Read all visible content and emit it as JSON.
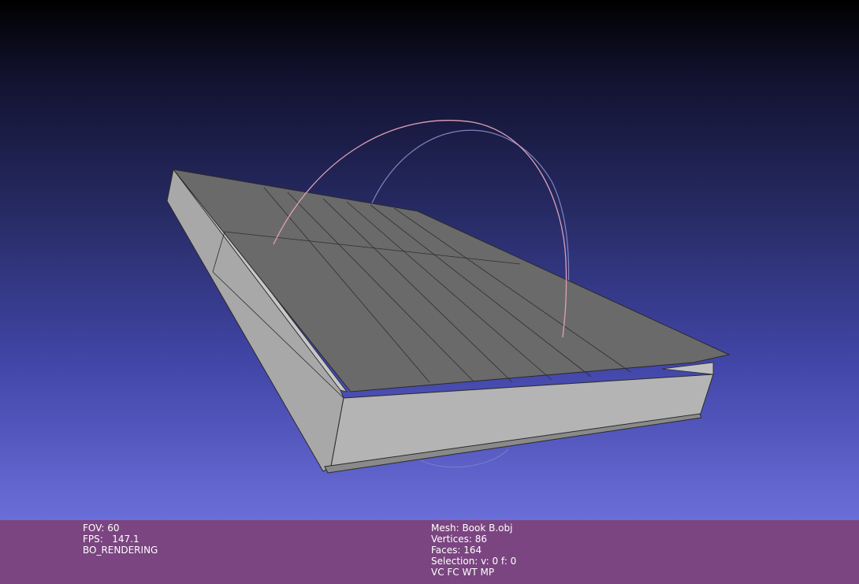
{
  "viewport": {
    "background_top": "#000000",
    "background_bottom": "#6a6ed8",
    "mesh_color": "#707070",
    "trackball": {
      "x_axis_color": "#e09aa8",
      "y_axis_color": "#9c9cd0",
      "z_axis_color": "#c8c8f0"
    }
  },
  "info_left": {
    "fov": "FOV: 60",
    "fps": "FPS:   147.1",
    "mode": "BO_RENDERING"
  },
  "info_right": {
    "mesh": "Mesh: Book B.obj",
    "vertices": "Vertices: 86",
    "faces": "Faces: 164",
    "selection": "Selection: v: 0 f: 0",
    "flags": "VC FC WT MP"
  },
  "infobar_color": "#7a4580"
}
